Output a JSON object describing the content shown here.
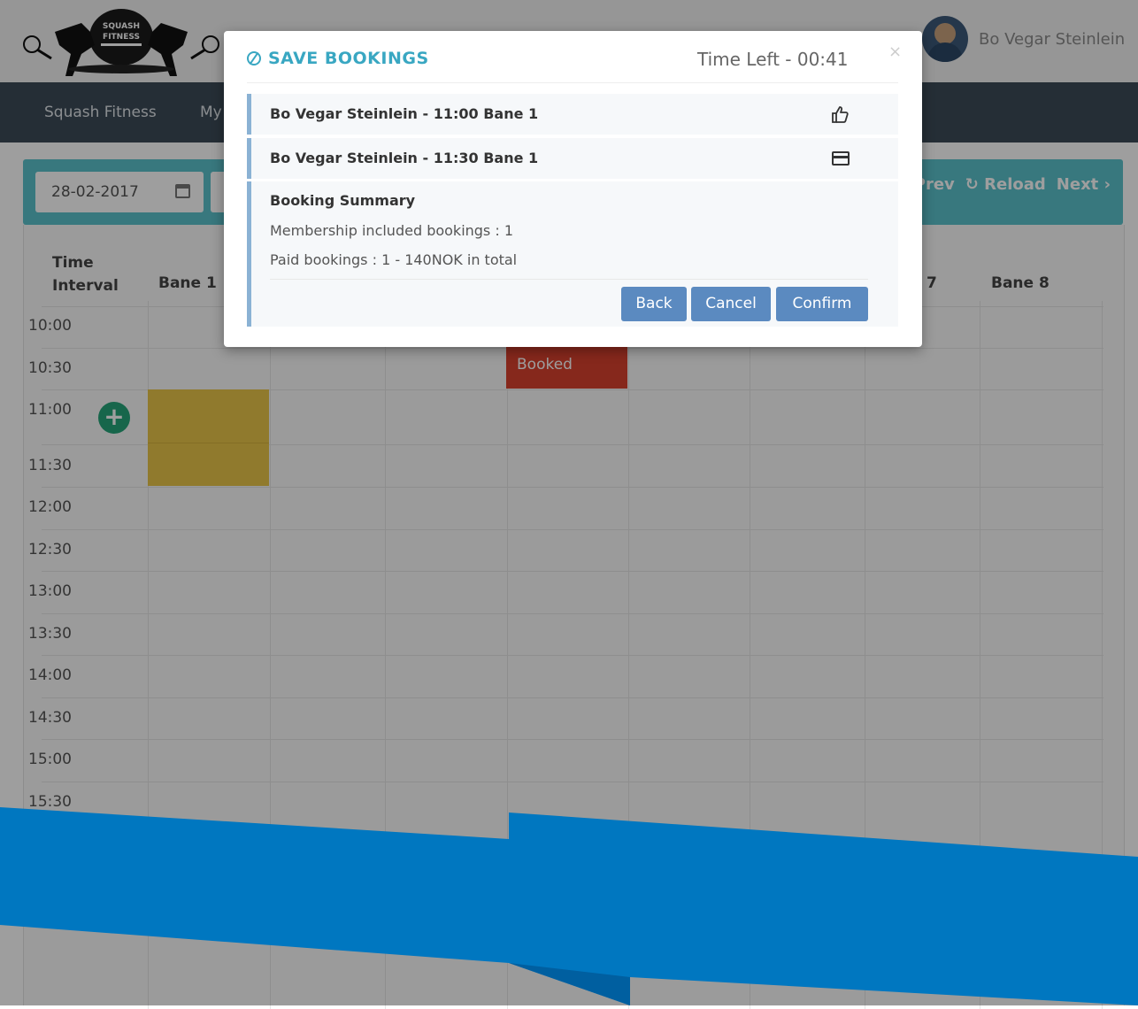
{
  "header": {
    "logo_text": "SQUASH FITNESS",
    "username": "Bo Vegar Steinlein"
  },
  "nav": {
    "items": [
      "Squash Fitness",
      "My"
    ]
  },
  "toolbar": {
    "date": "28-02-2017",
    "prev_label": "Prev",
    "reload_label": "Reload",
    "next_label": "Next"
  },
  "grid": {
    "time_header_line1": "Time",
    "time_header_line2": "Interval",
    "courts": [
      "Bane 1",
      "Bane 8"
    ],
    "times": [
      "10:00",
      "10:30",
      "11:00",
      "11:30",
      "12:00",
      "12:30",
      "13:00",
      "13:30",
      "14:00",
      "14:30",
      "15:00",
      "15:30"
    ],
    "booked_label": "Booked",
    "partial_header_char": "7"
  },
  "modal": {
    "title": "SAVE BOOKINGS",
    "time_left": "Time Left - 00:41",
    "close": "×",
    "bookings": [
      {
        "label": "Bo Vegar Steinlein - 11:00 Bane 1",
        "icon": "thumbs-up-icon"
      },
      {
        "label": "Bo Vegar Steinlein - 11:30 Bane 1",
        "icon": "credit-card-icon"
      }
    ],
    "summary": {
      "heading": "Booking Summary",
      "membership": "Membership included bookings : 1",
      "paid": "Paid bookings : 1 - 140NOK in total"
    },
    "buttons": {
      "back": "Back",
      "cancel": "Cancel",
      "confirm": "Confirm"
    }
  },
  "colors": {
    "accent": "#39a7c2",
    "button": "#5b8ac0",
    "booked": "#d9412e",
    "selected": "#e8c64a",
    "add": "#26a57a",
    "deco_blue": "#0077c0"
  }
}
